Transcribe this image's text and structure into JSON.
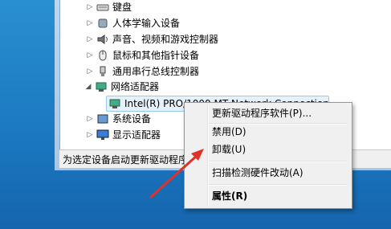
{
  "tree": {
    "items": [
      {
        "label": "键盘",
        "expanded": false
      },
      {
        "label": "人体学输入设备",
        "expanded": false
      },
      {
        "label": "声音、视频和游戏控制器",
        "expanded": false
      },
      {
        "label": "鼠标和其他指针设备",
        "expanded": false
      },
      {
        "label": "通用串行总线控制器",
        "expanded": false
      },
      {
        "label": "网络适配器",
        "expanded": true
      },
      {
        "label": "Intel(R) PRO/1000 MT Network Connection",
        "selected": true
      },
      {
        "label": "系统设备",
        "expanded": false
      },
      {
        "label": "显示适配器",
        "expanded": false
      }
    ]
  },
  "status": {
    "text": "为选定设备启动更新驱动程序"
  },
  "context_menu": {
    "items": [
      {
        "label": "更新驱动程序软件(P)..."
      },
      {
        "label": "禁用(D)"
      },
      {
        "label": "卸载(U)"
      },
      {
        "label": "扫描检测硬件改动(A)"
      },
      {
        "label": "属性(R)"
      }
    ]
  },
  "colors": {
    "accent": "#e0302a",
    "selection": "#cde8ff",
    "desktop": "#1a78c0"
  }
}
